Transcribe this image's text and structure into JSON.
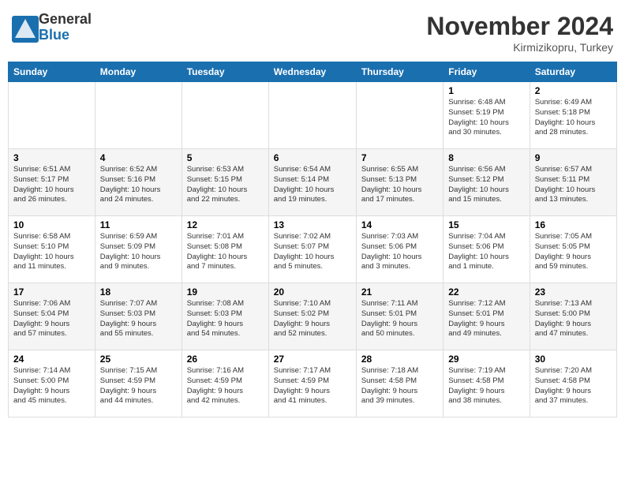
{
  "header": {
    "logo_general": "General",
    "logo_blue": "Blue",
    "month_title": "November 2024",
    "location": "Kirmizikopru, Turkey"
  },
  "weekdays": [
    "Sunday",
    "Monday",
    "Tuesday",
    "Wednesday",
    "Thursday",
    "Friday",
    "Saturday"
  ],
  "weeks": [
    [
      {
        "day": "",
        "info": ""
      },
      {
        "day": "",
        "info": ""
      },
      {
        "day": "",
        "info": ""
      },
      {
        "day": "",
        "info": ""
      },
      {
        "day": "",
        "info": ""
      },
      {
        "day": "1",
        "info": "Sunrise: 6:48 AM\nSunset: 5:19 PM\nDaylight: 10 hours\nand 30 minutes."
      },
      {
        "day": "2",
        "info": "Sunrise: 6:49 AM\nSunset: 5:18 PM\nDaylight: 10 hours\nand 28 minutes."
      }
    ],
    [
      {
        "day": "3",
        "info": "Sunrise: 6:51 AM\nSunset: 5:17 PM\nDaylight: 10 hours\nand 26 minutes."
      },
      {
        "day": "4",
        "info": "Sunrise: 6:52 AM\nSunset: 5:16 PM\nDaylight: 10 hours\nand 24 minutes."
      },
      {
        "day": "5",
        "info": "Sunrise: 6:53 AM\nSunset: 5:15 PM\nDaylight: 10 hours\nand 22 minutes."
      },
      {
        "day": "6",
        "info": "Sunrise: 6:54 AM\nSunset: 5:14 PM\nDaylight: 10 hours\nand 19 minutes."
      },
      {
        "day": "7",
        "info": "Sunrise: 6:55 AM\nSunset: 5:13 PM\nDaylight: 10 hours\nand 17 minutes."
      },
      {
        "day": "8",
        "info": "Sunrise: 6:56 AM\nSunset: 5:12 PM\nDaylight: 10 hours\nand 15 minutes."
      },
      {
        "day": "9",
        "info": "Sunrise: 6:57 AM\nSunset: 5:11 PM\nDaylight: 10 hours\nand 13 minutes."
      }
    ],
    [
      {
        "day": "10",
        "info": "Sunrise: 6:58 AM\nSunset: 5:10 PM\nDaylight: 10 hours\nand 11 minutes."
      },
      {
        "day": "11",
        "info": "Sunrise: 6:59 AM\nSunset: 5:09 PM\nDaylight: 10 hours\nand 9 minutes."
      },
      {
        "day": "12",
        "info": "Sunrise: 7:01 AM\nSunset: 5:08 PM\nDaylight: 10 hours\nand 7 minutes."
      },
      {
        "day": "13",
        "info": "Sunrise: 7:02 AM\nSunset: 5:07 PM\nDaylight: 10 hours\nand 5 minutes."
      },
      {
        "day": "14",
        "info": "Sunrise: 7:03 AM\nSunset: 5:06 PM\nDaylight: 10 hours\nand 3 minutes."
      },
      {
        "day": "15",
        "info": "Sunrise: 7:04 AM\nSunset: 5:06 PM\nDaylight: 10 hours\nand 1 minute."
      },
      {
        "day": "16",
        "info": "Sunrise: 7:05 AM\nSunset: 5:05 PM\nDaylight: 9 hours\nand 59 minutes."
      }
    ],
    [
      {
        "day": "17",
        "info": "Sunrise: 7:06 AM\nSunset: 5:04 PM\nDaylight: 9 hours\nand 57 minutes."
      },
      {
        "day": "18",
        "info": "Sunrise: 7:07 AM\nSunset: 5:03 PM\nDaylight: 9 hours\nand 55 minutes."
      },
      {
        "day": "19",
        "info": "Sunrise: 7:08 AM\nSunset: 5:03 PM\nDaylight: 9 hours\nand 54 minutes."
      },
      {
        "day": "20",
        "info": "Sunrise: 7:10 AM\nSunset: 5:02 PM\nDaylight: 9 hours\nand 52 minutes."
      },
      {
        "day": "21",
        "info": "Sunrise: 7:11 AM\nSunset: 5:01 PM\nDaylight: 9 hours\nand 50 minutes."
      },
      {
        "day": "22",
        "info": "Sunrise: 7:12 AM\nSunset: 5:01 PM\nDaylight: 9 hours\nand 49 minutes."
      },
      {
        "day": "23",
        "info": "Sunrise: 7:13 AM\nSunset: 5:00 PM\nDaylight: 9 hours\nand 47 minutes."
      }
    ],
    [
      {
        "day": "24",
        "info": "Sunrise: 7:14 AM\nSunset: 5:00 PM\nDaylight: 9 hours\nand 45 minutes."
      },
      {
        "day": "25",
        "info": "Sunrise: 7:15 AM\nSunset: 4:59 PM\nDaylight: 9 hours\nand 44 minutes."
      },
      {
        "day": "26",
        "info": "Sunrise: 7:16 AM\nSunset: 4:59 PM\nDaylight: 9 hours\nand 42 minutes."
      },
      {
        "day": "27",
        "info": "Sunrise: 7:17 AM\nSunset: 4:59 PM\nDaylight: 9 hours\nand 41 minutes."
      },
      {
        "day": "28",
        "info": "Sunrise: 7:18 AM\nSunset: 4:58 PM\nDaylight: 9 hours\nand 39 minutes."
      },
      {
        "day": "29",
        "info": "Sunrise: 7:19 AM\nSunset: 4:58 PM\nDaylight: 9 hours\nand 38 minutes."
      },
      {
        "day": "30",
        "info": "Sunrise: 7:20 AM\nSunset: 4:58 PM\nDaylight: 9 hours\nand 37 minutes."
      }
    ]
  ]
}
